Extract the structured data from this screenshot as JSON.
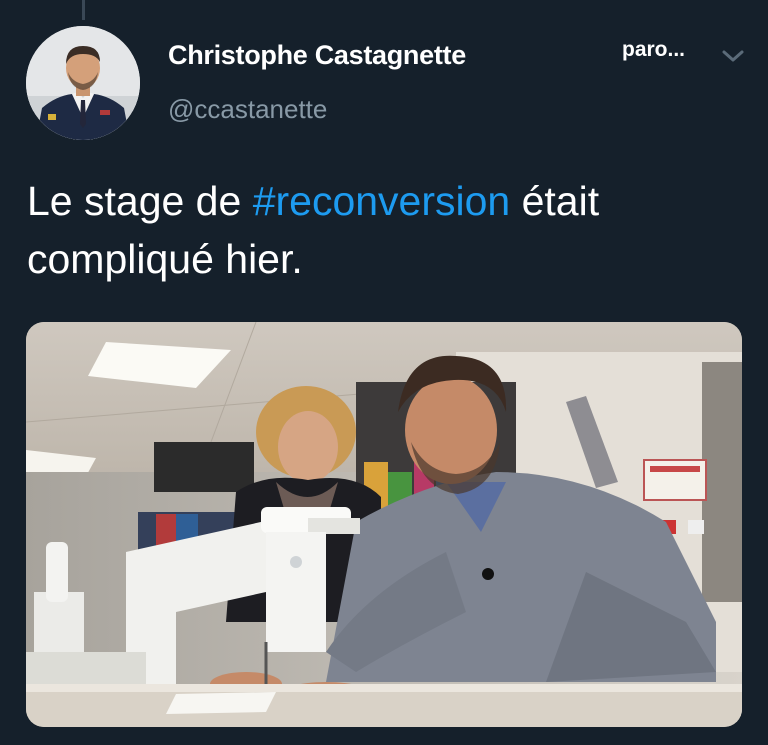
{
  "tweet": {
    "author": {
      "display_name": "Christophe Castagnette",
      "handle": "@ccastanette",
      "avatar_icon": "profile-photo"
    },
    "badge_label": "paro...",
    "menu_icon": "chevron-down-icon",
    "text": {
      "before_hashtag": "Le stage de ",
      "hashtag": "#reconversion",
      "after_hashtag": " était compliqué hier."
    },
    "media": {
      "type": "photo",
      "icon": "photo-sewing-workshop"
    }
  },
  "colors": {
    "background": "#15202b",
    "text_primary": "#ffffff",
    "text_secondary": "#8899a6",
    "link": "#1d9bf0"
  }
}
